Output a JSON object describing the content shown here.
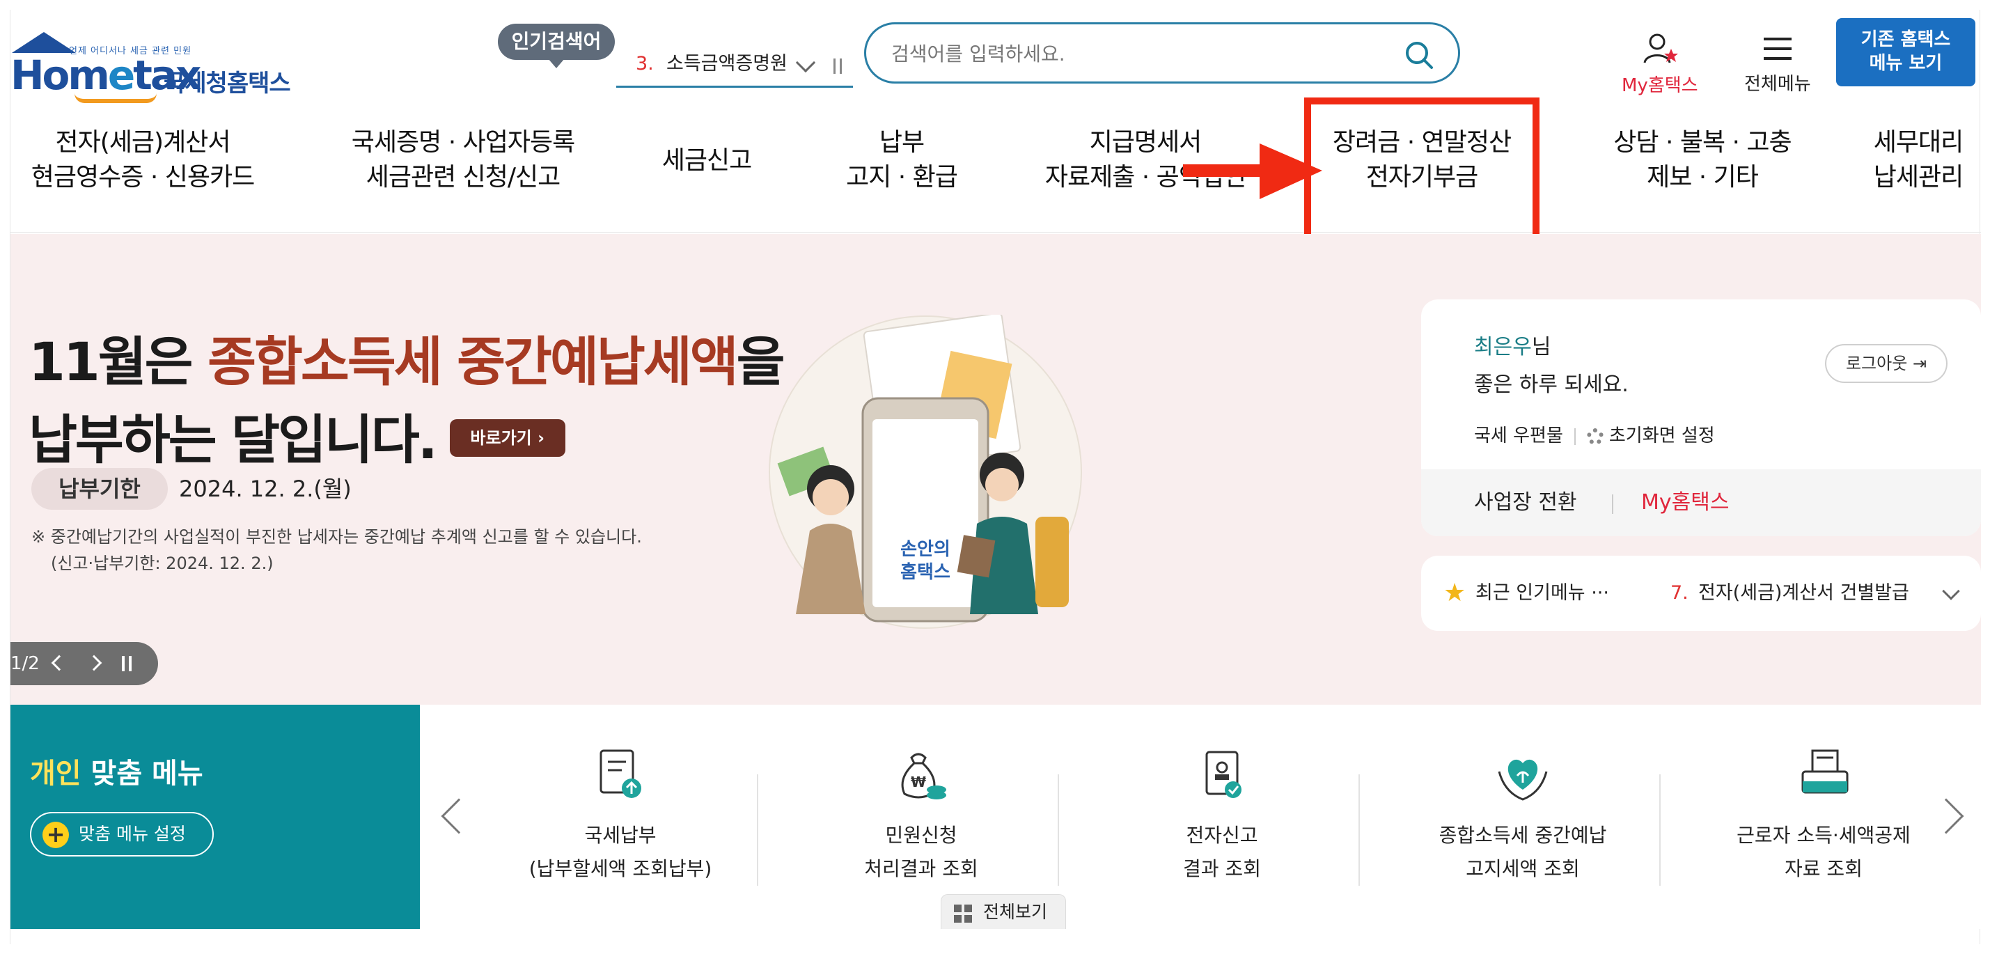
{
  "header": {
    "logo_tag": "언제 어디서나 세금 관련 민원",
    "logo_word_pre": "Hom",
    "logo_word_e": "e",
    "logo_word_post": "tax",
    "logo_kor": "국세청홈택스",
    "popular_badge": "인기검색어",
    "popular_rank_num": "3.",
    "popular_rank_text": "소득금액증명원",
    "search_placeholder": "검색어를 입력하세요.",
    "my_home_label": "My홈택스",
    "all_menu_label": "전체메뉴",
    "old_home_line1": "기존 홈택스",
    "old_home_line2": "메뉴 보기"
  },
  "nav": [
    {
      "line1": "전자(세금)계산서",
      "line2": "현금영수증 · 신용카드"
    },
    {
      "line1": "국세증명 · 사업자등록",
      "line2": "세금관련 신청/신고"
    },
    {
      "line1": "세금신고",
      "line2": ""
    },
    {
      "line1": "납부",
      "line2": "고지 · 환급"
    },
    {
      "line1": "지급명세서",
      "line2": "자료제출 · 공익법인"
    },
    {
      "line1": "장려금 · 연말정산",
      "line2": "전자기부금"
    },
    {
      "line1": "상담 · 불복 · 고충",
      "line2": "제보 · 기타"
    },
    {
      "line1": "세무대리",
      "line2": "납세관리"
    }
  ],
  "hero": {
    "title_l1_pre": "11월은 ",
    "title_l1_accent": "종합소득세 중간예납세액",
    "title_l1_post": "을",
    "title_l2": "납부하는 달입니다.",
    "go_label": "바로가기",
    "deadline_label": "납부기한",
    "deadline_date": "2024. 12. 2.(월)",
    "note_l1": "※ 중간예납기간의 사업실적이 부진한 납세자는 중간예납 추계액 신고를 할 수 있습니다.",
    "note_l2": "(신고·납부기한: 2024. 12. 2.)",
    "slide_count": "1/2",
    "illus_line1": "손안의",
    "illus_line2": "홈택스"
  },
  "user": {
    "name": "최은우",
    "honorific": "님",
    "greeting": "좋은 하루 되세요.",
    "logout_label": "로그아웃",
    "mail_label": "국세 우편물",
    "settings_label": "초기화면 설정",
    "switch_label": "사업장 전환",
    "my_home_label": "My홈택스"
  },
  "popular_menu": {
    "title": "최근 인기메뉴",
    "num": "7.",
    "item": "전자(세금)계산서 건별발급"
  },
  "custom_menu": {
    "title_hl": "개인",
    "title_rest": " 맞춤 메뉴",
    "setting_label": "맞춤 메뉴 설정"
  },
  "quick_items": [
    {
      "icon": "tax-payment-icon",
      "line1": "국세납부",
      "line2": "(납부할세액 조회납부)"
    },
    {
      "icon": "money-bag-icon",
      "line1": "민원신청",
      "line2": "처리결과 조회"
    },
    {
      "icon": "document-stamp-icon",
      "line1": "전자신고",
      "line2": "결과 조회"
    },
    {
      "icon": "heart-hands-icon",
      "line1": "종합소득세 중간예납",
      "line2": "고지세액 조회"
    },
    {
      "icon": "printer-doc-icon",
      "line1": "근로자 소득·세액공제",
      "line2": "자료 조회"
    }
  ],
  "all_view_label": "전체보기",
  "colors": {
    "brand_blue": "#1e4f9c",
    "teal": "#0a8c98",
    "accent_red": "#f02a13",
    "hero_bg": "#f9eeee"
  }
}
